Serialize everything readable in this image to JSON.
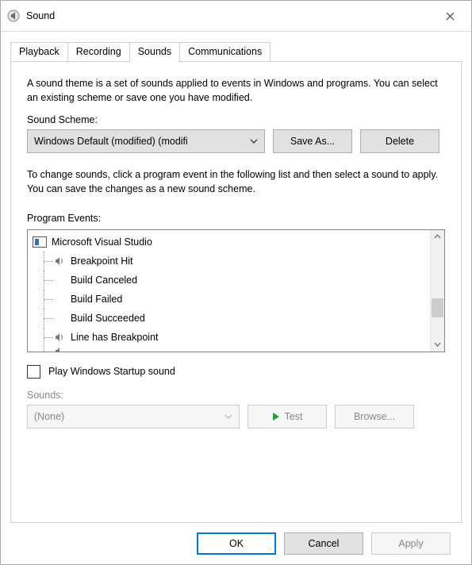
{
  "window": {
    "title": "Sound"
  },
  "tabs": [
    "Playback",
    "Recording",
    "Sounds",
    "Communications"
  ],
  "active_tab_index": 2,
  "intro": "A sound theme is a set of sounds applied to events in Windows and programs.  You can select an existing scheme or save one you have modified.",
  "scheme": {
    "label": "Sound Scheme:",
    "selected": "Windows Default (modified) (modifi",
    "save_as_label": "Save As...",
    "delete_label": "Delete"
  },
  "change_text": "To change sounds, click a program event in the following list and then select a sound to apply.  You can save the changes as a new sound scheme.",
  "events": {
    "label": "Program Events:",
    "root": "Microsoft Visual Studio",
    "items": [
      {
        "label": "Breakpoint Hit",
        "has_sound": true
      },
      {
        "label": "Build Canceled",
        "has_sound": false
      },
      {
        "label": "Build Failed",
        "has_sound": false
      },
      {
        "label": "Build Succeeded",
        "has_sound": false
      },
      {
        "label": "Line has Breakpoint",
        "has_sound": true
      }
    ]
  },
  "startup": {
    "label": "Play Windows Startup sound",
    "checked": false
  },
  "sounds": {
    "label": "Sounds:",
    "selected": "(None)",
    "test_label": "Test",
    "browse_label": "Browse...",
    "enabled": false
  },
  "footer": {
    "ok": "OK",
    "cancel": "Cancel",
    "apply": "Apply"
  },
  "colors": {
    "primary": "#0078d7",
    "play_triangle": "#2e9b3a"
  }
}
